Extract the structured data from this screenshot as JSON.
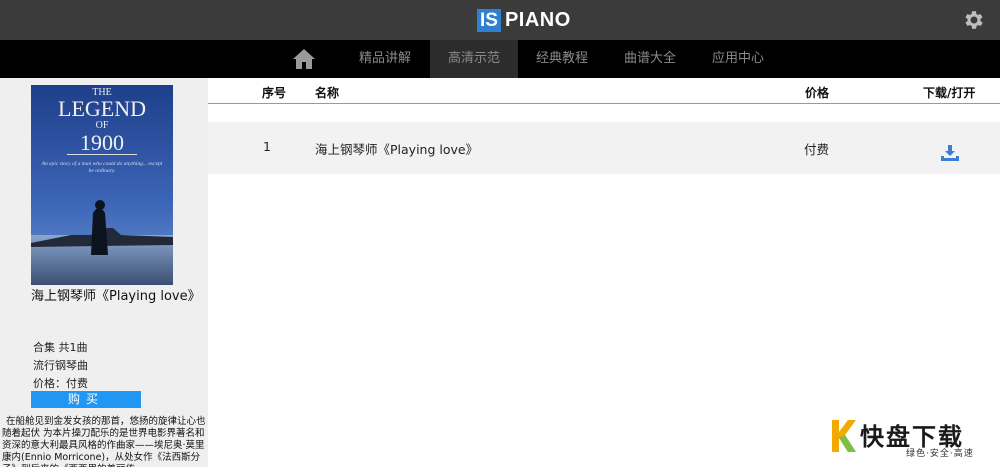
{
  "header": {
    "logo_box": "IS",
    "logo_text": "PIANO"
  },
  "nav": {
    "items": [
      {
        "label": "精品讲解"
      },
      {
        "label": "高清示范"
      },
      {
        "label": "经典教程"
      },
      {
        "label": "曲谱大全"
      },
      {
        "label": "应用中心"
      }
    ],
    "active": "高清示范"
  },
  "sidebar": {
    "cover": {
      "title_line1": "THE",
      "title_line2": "LEGEND",
      "title_line3": "OF",
      "title_line4": "1900",
      "tagline": "An epic story of a man who could do anything... except be ordinary."
    },
    "title": "海上钢琴师《Playing love》",
    "collection": "合集  共1曲",
    "category": "流行钢琴曲",
    "price": "价格：付费",
    "buy_label": "购买",
    "description": "在船舱见到金发女孩的那首，悠扬的旋律让心也随着起伏  为本片操刀配乐的是世界电影界著名和资深的意大利最具风格的作曲家——埃尼奥·莫里康内(Ennio Morricone)，从处女作《法西斯分子》到后来的《西西里的美丽传"
  },
  "table": {
    "headers": {
      "index": "序号",
      "name": "名称",
      "price": "价格",
      "download": "下载/打开"
    },
    "rows": [
      {
        "index": "1",
        "name": "海上钢琴师《Playing love》",
        "price": "付费"
      }
    ]
  },
  "watermark": {
    "title": "快盘下载",
    "subtitle": "绿色·安全·高速"
  },
  "colors": {
    "topbar": "#3b3b3b",
    "navbar": "#000000",
    "accent": "#2196f3",
    "sidebar_bg": "#efefef"
  }
}
